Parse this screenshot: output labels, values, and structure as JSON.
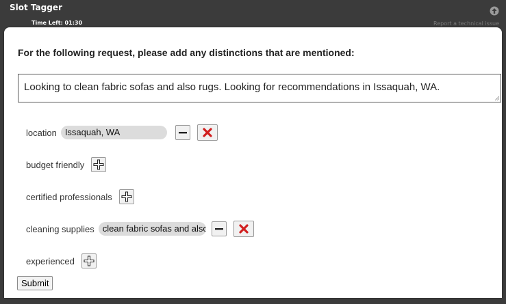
{
  "app": {
    "title": "Slot Tagger",
    "timer": "Time Left: 01:30",
    "report_link": "Report a technical issue"
  },
  "task": {
    "instruction": "For the following request, please add any distinctions that are mentioned:",
    "request_text": "Looking to clean fabric sofas and also rugs. Looking for recommendations in Issaquah, WA."
  },
  "slots": [
    {
      "label": "location",
      "value": "Issaquah, WA",
      "has_value": true
    },
    {
      "label": "budget friendly",
      "value": "",
      "has_value": false
    },
    {
      "label": "certified professionals",
      "value": "",
      "has_value": false
    },
    {
      "label": "cleaning supplies",
      "value": "clean fabric sofas and also",
      "has_value": true
    },
    {
      "label": "experienced",
      "value": "",
      "has_value": false
    }
  ],
  "submit_label": "Submit",
  "colors": {
    "header_bg": "#3b3b3b",
    "delete_red": "#d11f1f",
    "chip_bg": "#dcdcdc"
  },
  "icons": {
    "scroll_top": "circle-up-arrow-icon",
    "add": "plus-icon",
    "minimize": "minus-icon",
    "delete": "x-icon"
  }
}
